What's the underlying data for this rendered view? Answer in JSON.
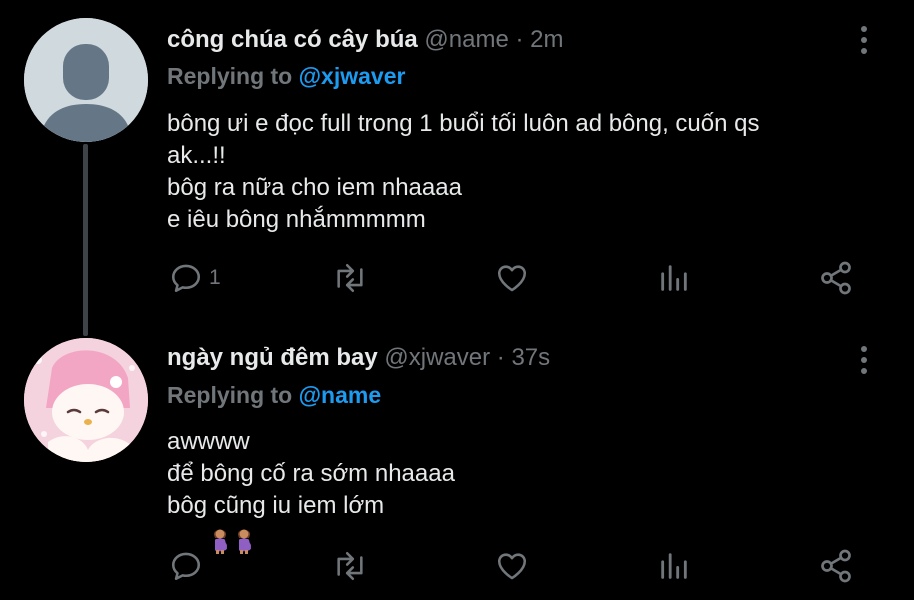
{
  "tweets": [
    {
      "display_name": "công chúa có cây búa",
      "handle": "@name",
      "time": "2m",
      "separator": "·",
      "replying_label": "Replying to",
      "replying_handle": "@xjwaver",
      "lines": [
        "bông ưi e đọc full trong 1 buổi tối luôn ad bông, cuốn qs",
        "ak...!!",
        "bôg ra nữa cho iem nhaaaa",
        "e iêu bông nhắmmmmm"
      ],
      "reply_count": "1",
      "avatar": "default-avatar"
    },
    {
      "display_name": "ngày ngủ đêm bay",
      "handle": "@xjwaver",
      "time": "37s",
      "separator": "·",
      "replying_label": "Replying to",
      "replying_handle": "@name",
      "lines": [
        "awwww",
        "để bông cố ra sớm nhaaaa",
        "bôg cũng iu iem lớm"
      ],
      "reply_count": "",
      "avatar": "my-melody-avatar"
    }
  ],
  "icons": {
    "reply": "reply-icon",
    "retweet": "retweet-icon",
    "like": "heart-icon",
    "views": "analytics-icon",
    "share": "share-icon",
    "more": "more-options-icon",
    "emoji": "pregnant-woman-emoji"
  },
  "colors": {
    "background": "#000000",
    "text": "#e7e9ea",
    "muted": "#71767b",
    "link": "#1d9bf0"
  }
}
